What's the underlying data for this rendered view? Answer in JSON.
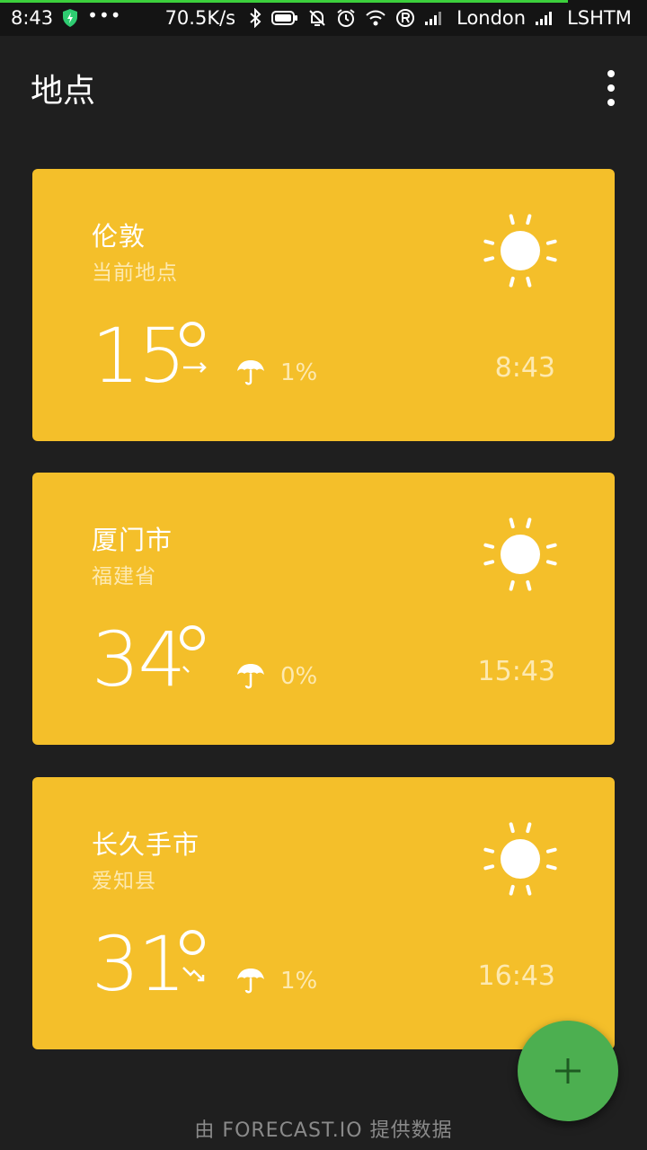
{
  "status_bar": {
    "time": "8:43",
    "more": "•••",
    "net_speed": "70.5K/s",
    "carrier1": "London",
    "carrier2": "LSHTM",
    "accent_color": "#3ccf3c"
  },
  "app_bar": {
    "title": "地点",
    "menu_icon": "more-vert-icon"
  },
  "locations": [
    {
      "name": "伦敦",
      "region": "当前地点",
      "temperature": "15",
      "trend": "steady",
      "precipitation": "1%",
      "local_time": "8:43",
      "condition_icon": "sun-icon"
    },
    {
      "name": "厦门市",
      "region": "福建省",
      "temperature": "34",
      "trend": "falling-slight",
      "precipitation": "0%",
      "local_time": "15:43",
      "condition_icon": "sun-icon"
    },
    {
      "name": "长久手市",
      "region": "爱知县",
      "temperature": "31",
      "trend": "falling",
      "precipitation": "1%",
      "local_time": "16:43",
      "condition_icon": "sun-icon"
    }
  ],
  "colors": {
    "card": "#f4bf2a",
    "fab": "#4caf50",
    "background": "#1f1f1f"
  },
  "footer": "由 FORECAST.IO 提供数据",
  "fab": {
    "icon": "plus-icon"
  }
}
